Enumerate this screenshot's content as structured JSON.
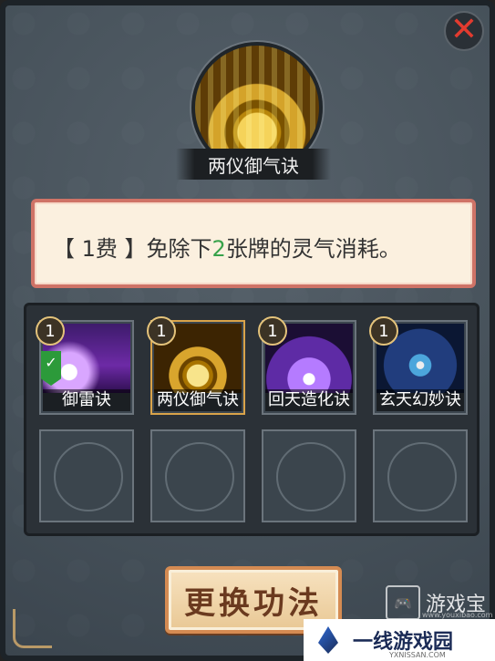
{
  "dialog": {
    "skill_name": "两仪御气诀",
    "description_prefix": "【 1费 】免除下",
    "description_number": "2",
    "description_suffix": "张牌的灵气消耗。",
    "close_icon": "close-icon",
    "change_button_label": "更换功法"
  },
  "skills": [
    {
      "name": "御雷诀",
      "cost": "1",
      "selected": true
    },
    {
      "name": "两仪御气诀",
      "cost": "1",
      "selected": false
    },
    {
      "name": "回天造化诀",
      "cost": "1",
      "selected": false
    },
    {
      "name": "玄天幻妙诀",
      "cost": "1",
      "selected": false
    }
  ],
  "watermarks": {
    "left_title": "游戏宝",
    "left_url": "www.youxibao.com",
    "right_title": "一线游戏园",
    "right_url": "YXNISSAN.COM"
  }
}
